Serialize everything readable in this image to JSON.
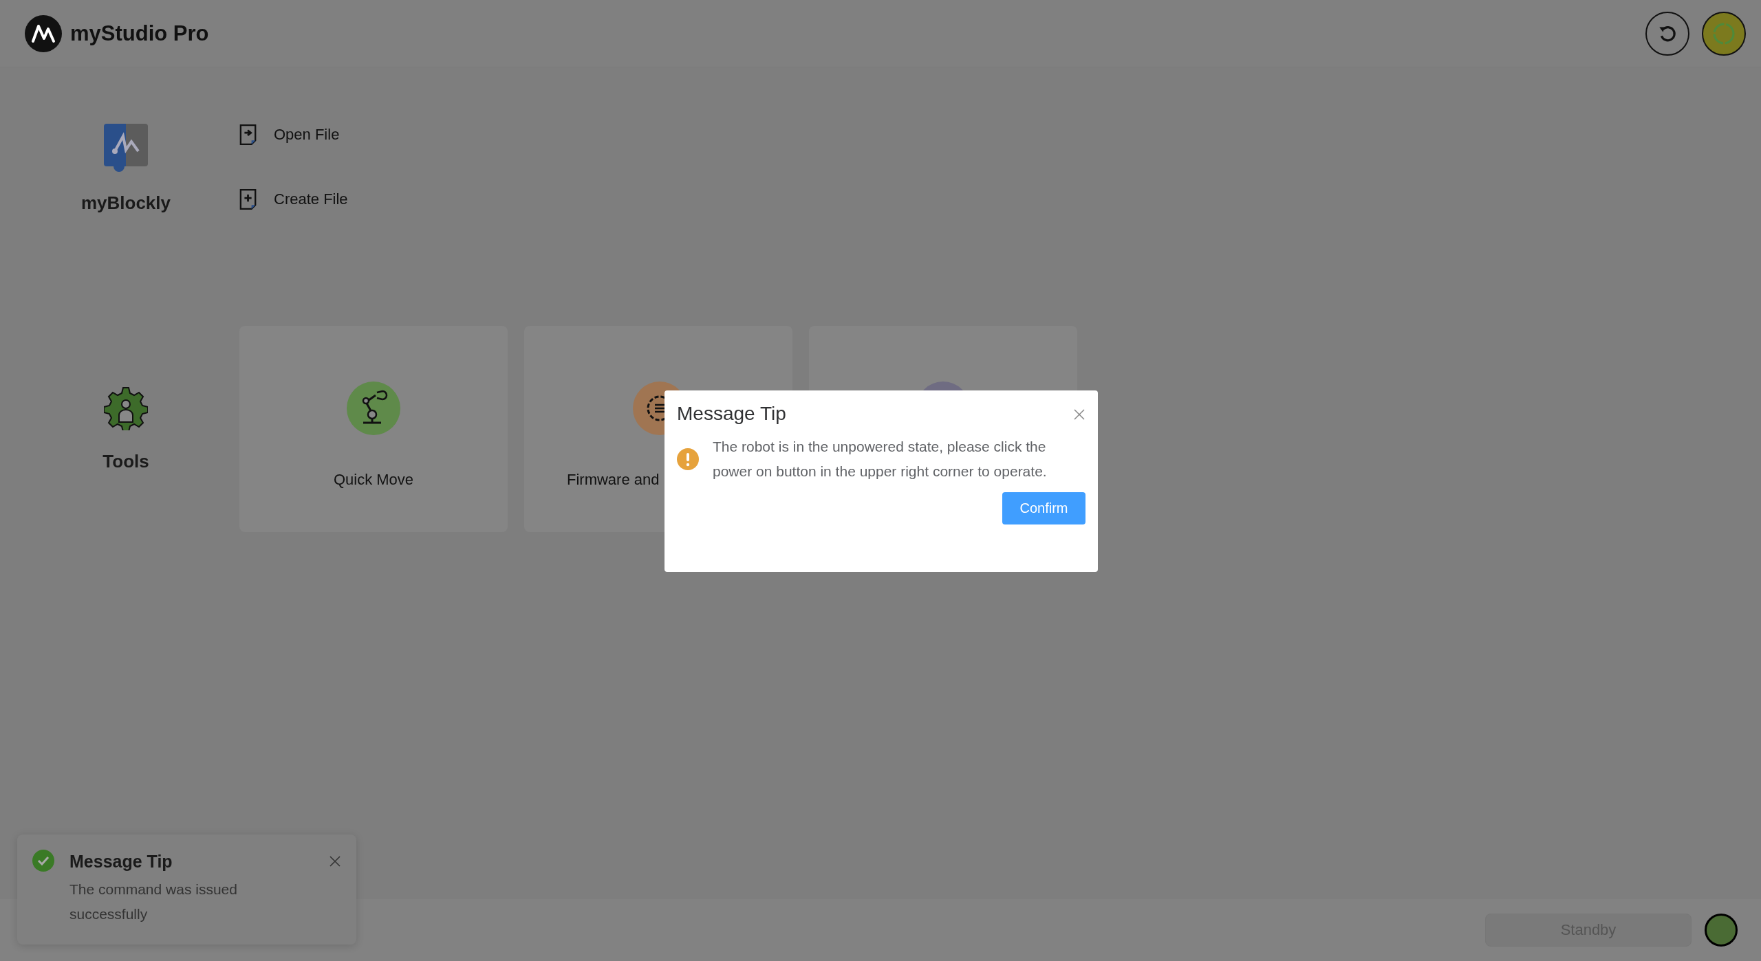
{
  "header": {
    "title": "myStudio Pro"
  },
  "sections": [
    {
      "label": "myBlockly",
      "kind": "blockly",
      "actions": [
        {
          "label": "Open File",
          "kind": "open"
        },
        {
          "label": "Create File",
          "kind": "create"
        }
      ]
    },
    {
      "label": "Tools",
      "kind": "tools",
      "cards": [
        {
          "label": "Quick Move",
          "kind": "arm",
          "color": "#5f8a4a"
        },
        {
          "label": "Firmware and",
          "kind": "firmware",
          "color": "#a07552"
        },
        {
          "kind": "other",
          "color": "#6f6c82"
        }
      ]
    }
  ],
  "dialog": {
    "title": "Message Tip",
    "message": "The robot is in the unpowered state, please click the power on button in the upper right corner to operate.",
    "button": "Confirm"
  },
  "toast": {
    "title": "Message Tip",
    "message": "The command was issued successfully"
  },
  "footer": {
    "status": "Standby"
  }
}
